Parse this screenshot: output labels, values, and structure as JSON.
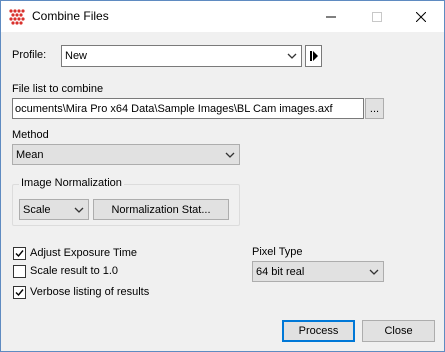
{
  "window": {
    "title": "Combine Files",
    "close_glyph": "✕",
    "minimize_glyph": "—"
  },
  "profile": {
    "label": "Profile:",
    "value": "New"
  },
  "file_list": {
    "label": "File list to combine",
    "value": "ocuments\\Mira Pro x64 Data\\Sample Images\\BL Cam images.axf",
    "browse_label": "..."
  },
  "method": {
    "label": "Method",
    "value": "Mean"
  },
  "normalization": {
    "group_title": "Image Normalization",
    "mode_value": "Scale",
    "stats_button": "Normalization Stat..."
  },
  "options": [
    {
      "label": "Adjust Exposure Time",
      "checked": true
    },
    {
      "label": "Scale result to 1.0",
      "checked": false
    },
    {
      "label": "Verbose listing of results",
      "checked": true
    }
  ],
  "pixel_type": {
    "label": "Pixel Type",
    "value": "64 bit real"
  },
  "buttons": {
    "process": "Process",
    "close": "Close"
  }
}
